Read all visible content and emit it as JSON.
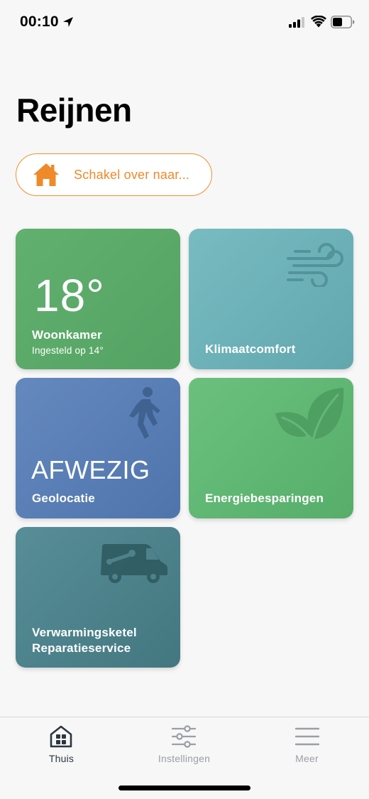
{
  "status_bar": {
    "time": "00:10",
    "icons": [
      "location-arrow-icon",
      "cellular-signal-icon",
      "wifi-icon",
      "battery-icon"
    ]
  },
  "header": {
    "title": "Reijnen"
  },
  "switch_button": {
    "label": "Schakel over naar...",
    "icon": "house-icon",
    "accent_color": "#f0902d"
  },
  "tiles": {
    "living_room": {
      "temperature": "18°",
      "title": "Woonkamer",
      "subtitle": "Ingesteld op 14°",
      "color": "#5aaa69"
    },
    "climate": {
      "title": "Klimaatcomfort",
      "icon": "wind-icon",
      "color": "#6db1b8"
    },
    "geolocation": {
      "status": "AFWEZIG",
      "title": "Geolocatie",
      "icon": "walking-person-icon",
      "color": "#5a7fb6"
    },
    "energy": {
      "title": "Energiebesparingen",
      "icon": "leaves-icon",
      "color": "#60b774"
    },
    "service": {
      "title_line1": "Verwarmingsketel",
      "title_line2": "Reparatieservice",
      "icon": "service-van-icon",
      "color": "#4d828b"
    }
  },
  "tab_bar": {
    "tabs": [
      {
        "label": "Thuis",
        "icon": "home-grid-icon",
        "active": true
      },
      {
        "label": "Instellingen",
        "icon": "sliders-icon",
        "active": false
      },
      {
        "label": "Meer",
        "icon": "menu-icon",
        "active": false
      }
    ]
  }
}
